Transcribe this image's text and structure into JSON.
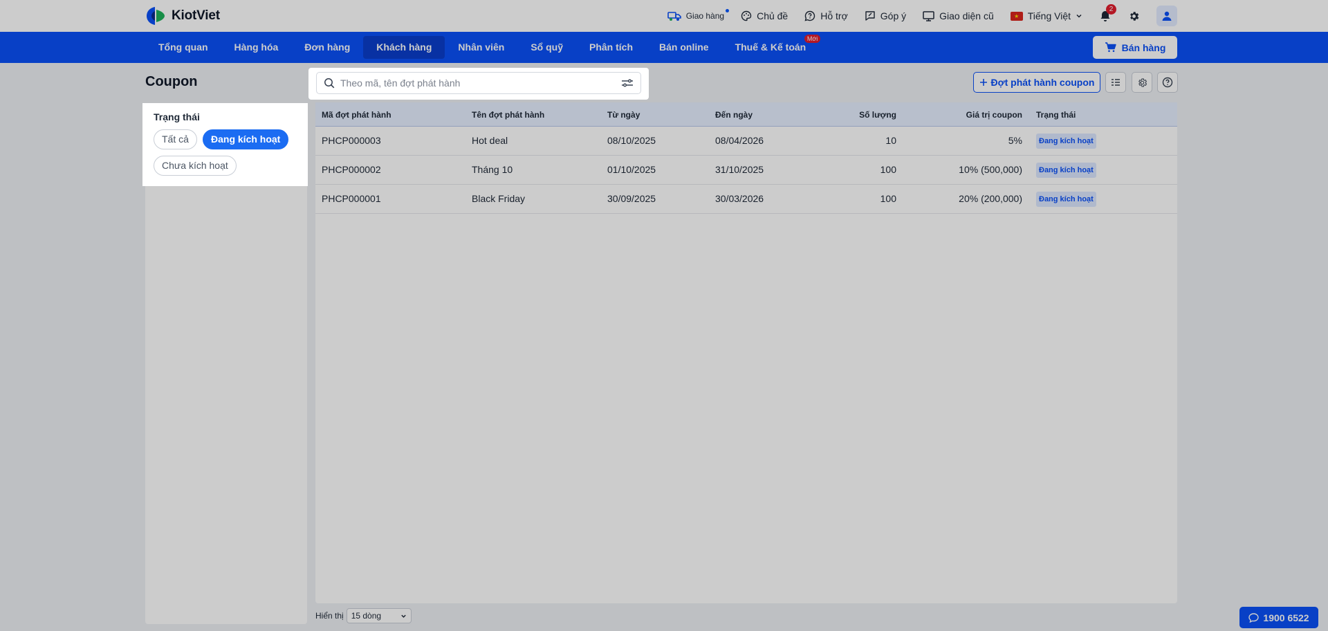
{
  "app": {
    "brand": "KiotViet"
  },
  "topbar": {
    "delivery": "Giao hàng",
    "theme": "Chủ đề",
    "support": "Hỗ trợ",
    "feedback": "Góp ý",
    "old_ui": "Giao diện cũ",
    "language": "Tiếng Việt",
    "notifications_count": "2"
  },
  "nav": {
    "items": [
      {
        "label": "Tổng quan"
      },
      {
        "label": "Hàng hóa"
      },
      {
        "label": "Đơn hàng"
      },
      {
        "label": "Khách hàng"
      },
      {
        "label": "Nhân viên"
      },
      {
        "label": "Sổ quỹ"
      },
      {
        "label": "Phân tích"
      },
      {
        "label": "Bán online"
      },
      {
        "label": "Thuế & Kế toán"
      }
    ],
    "active_index": 3,
    "new_badge": "Mới",
    "sell_button": "Bán hàng"
  },
  "page": {
    "title": "Coupon"
  },
  "search": {
    "placeholder": "Theo mã, tên đợt phát hành",
    "value": ""
  },
  "actions": {
    "add_coupon": "Đợt phát hành coupon"
  },
  "filter": {
    "title": "Trạng thái",
    "options": [
      "Tất cả",
      "Đang kích hoạt",
      "Chưa kích hoạt"
    ],
    "selected": "Đang kích hoạt"
  },
  "table": {
    "columns": [
      "Mã đợt phát hành",
      "Tên đợt phát hành",
      "Từ ngày",
      "Đến ngày",
      "Số lượng",
      "Giá trị coupon",
      "Trạng thái"
    ],
    "rows": [
      {
        "code": "PHCP000003",
        "name": "Hot deal",
        "from": "08/10/2025",
        "to": "08/04/2026",
        "qty": "10",
        "value": "5%",
        "status": "Đang kích hoạt"
      },
      {
        "code": "PHCP000002",
        "name": "Tháng 10",
        "from": "01/10/2025",
        "to": "31/10/2025",
        "qty": "100",
        "value": "10% (500,000)",
        "status": "Đang kích hoạt"
      },
      {
        "code": "PHCP000001",
        "name": "Black Friday",
        "from": "30/09/2025",
        "to": "30/03/2026",
        "qty": "100",
        "value": "20% (200,000)",
        "status": "Đang kích hoạt"
      }
    ]
  },
  "pagination": {
    "label": "Hiển thị",
    "page_size": "15 dòng"
  },
  "hotline": "1900 6522",
  "colors": {
    "primary": "#0b50f8",
    "active_nav": "#0a3ecc",
    "badge_red": "#e11d2e"
  }
}
